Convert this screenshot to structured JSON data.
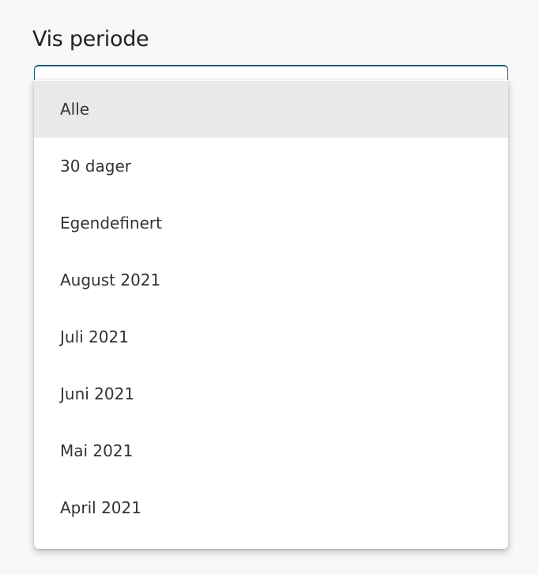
{
  "field": {
    "label": "Vis periode"
  },
  "dropdown": {
    "selected_index": 0,
    "options": [
      {
        "label": "Alle"
      },
      {
        "label": "30 dager"
      },
      {
        "label": "Egendefinert"
      },
      {
        "label": "August 2021"
      },
      {
        "label": "Juli 2021"
      },
      {
        "label": "Juni 2021"
      },
      {
        "label": "Mai 2021"
      },
      {
        "label": "April 2021"
      }
    ]
  },
  "colors": {
    "background": "#f8f8f8",
    "focus_border": "#1e5a74",
    "selected_bg": "#e9e9e9",
    "text": "#333333"
  }
}
